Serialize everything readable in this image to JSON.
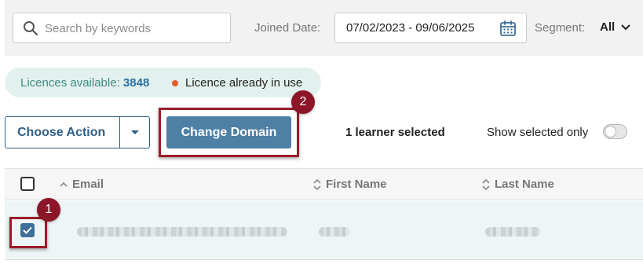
{
  "filters": {
    "search_placeholder": "Search by keywords",
    "joined_label": "Joined Date:",
    "date_range": "07/02/2023 - 09/06/2025",
    "segment_label": "Segment:",
    "segment_value": "All"
  },
  "licence": {
    "available_label": "Licences available:",
    "available_count": "3848",
    "in_use_label": "Licence already in use"
  },
  "actions": {
    "choose_action": "Choose Action",
    "change_domain": "Change Domain",
    "selected_count": "1 learner selected",
    "show_selected_only": "Show selected only",
    "show_selected_on": false
  },
  "table": {
    "columns": [
      "Email",
      "First Name",
      "Last Name"
    ],
    "rows": [
      {
        "checked": true,
        "email": "",
        "first_name": "",
        "last_name": ""
      }
    ]
  },
  "annotations": {
    "badge_1": "1",
    "badge_2": "2"
  },
  "colors": {
    "primary": "#4e7fa5",
    "highlight": "#9c1b2b",
    "licence_bg": "#e3f1ee",
    "status_dot": "#e35b2a"
  }
}
